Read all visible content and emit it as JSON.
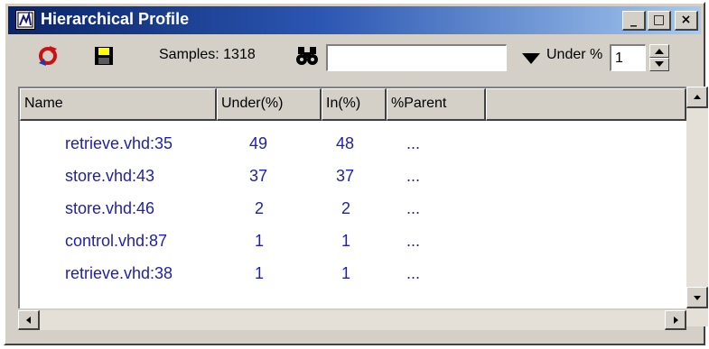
{
  "window": {
    "title": "Hierarchical Profile",
    "controls": {
      "minimize": "_",
      "maximize": "□",
      "close": "×"
    }
  },
  "toolbar": {
    "refresh_icon": "refresh-icon",
    "save_icon": "floppy-save-icon",
    "samples_text": "Samples: 1318",
    "find_icon": "binoculars-icon",
    "search_value": "",
    "dropdown_icon": "triangle-down-icon",
    "under_label": "Under %",
    "under_value": "1"
  },
  "table": {
    "columns": [
      "Name",
      "Under(%)",
      "In(%)",
      "%Parent"
    ],
    "rows": [
      {
        "name": "retrieve.vhd:35",
        "under": "49",
        "in": "48",
        "parent": "..."
      },
      {
        "name": "store.vhd:43",
        "under": "37",
        "in": "37",
        "parent": "..."
      },
      {
        "name": "store.vhd:46",
        "under": "2",
        "in": "2",
        "parent": "..."
      },
      {
        "name": "control.vhd:87",
        "under": "1",
        "in": "1",
        "parent": "..."
      },
      {
        "name": "retrieve.vhd:38",
        "under": "1",
        "in": "1",
        "parent": "..."
      }
    ]
  },
  "colors": {
    "title_start": "#0a246a",
    "title_end": "#a6caf0",
    "row_text": "#1e1eb4",
    "face": "#d4d0c8"
  }
}
